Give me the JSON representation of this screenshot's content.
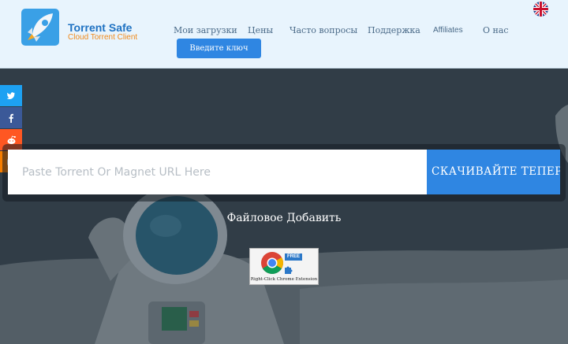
{
  "brand": {
    "name": "Torrent Safe",
    "tagline": "Cloud Torrent Client"
  },
  "nav": [
    {
      "label": "Мои загрузки"
    },
    {
      "label": "Цены"
    },
    {
      "label": "Часто вопросы"
    },
    {
      "label": "Поддержка"
    },
    {
      "label": "Affiliates"
    },
    {
      "label": "О нас"
    }
  ],
  "enter_key_label": "Введите ключ",
  "language_icon": "uk-flag-icon",
  "social": [
    "twitter-icon",
    "facebook-icon",
    "reddit-icon",
    "blogger-icon"
  ],
  "colors": {
    "twitter": "#1da1f2",
    "facebook": "#3b5998",
    "reddit": "#ff5722",
    "blogger": "#f57d00",
    "accent": "#2f86e2"
  },
  "search": {
    "placeholder": "Paste Torrent Or Magnet URL Here",
    "value": ""
  },
  "download_button_label": "СКАЧИВАЙТЕ ТЕПЕРЬ",
  "file_add_label": "Файловое Добавить",
  "chrome_extension": {
    "badge": "FREE",
    "caption": "Right-Click Chrome Extension"
  }
}
